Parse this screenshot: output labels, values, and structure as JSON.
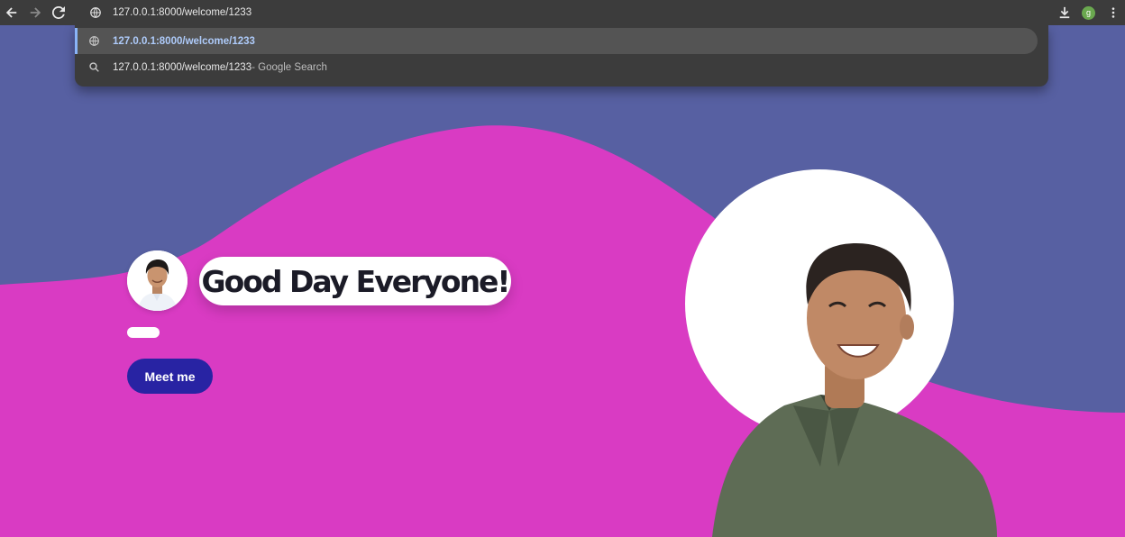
{
  "browser": {
    "url": "127.0.0.1:8000/welcome/1233",
    "profile_initial": "g",
    "suggestions": [
      {
        "text": "127.0.0.1:8000/welcome/1233",
        "suffix": "",
        "icon": "globe-icon"
      },
      {
        "text": "127.0.0.1:8000/welcome/1233",
        "suffix": " - Google Search",
        "icon": "search-icon"
      }
    ]
  },
  "hero": {
    "greeting": "Good Day Everyone!",
    "cta_label": "Meet me"
  },
  "colors": {
    "background_blue": "#5760a2",
    "wave_magenta": "#d93bc3",
    "button_navy": "#2823a3",
    "chrome_dark": "#3c3c3c"
  }
}
